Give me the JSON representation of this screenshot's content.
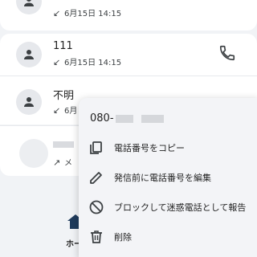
{
  "call_log": {
    "entries": [
      {
        "name": "",
        "direction_icon": "incoming-arrow-icon",
        "date": "6月15日 14:15"
      },
      {
        "name": "111",
        "direction_icon": "incoming-arrow-icon",
        "date": "6月15日 14:15"
      },
      {
        "name": "不明",
        "direction_icon": "incoming-arrow-icon",
        "date": "6月"
      },
      {
        "name": "",
        "direction_icon": "outgoing-arrow-icon",
        "date": "メ"
      }
    ]
  },
  "bottom_nav": {
    "home_label": "ホー"
  },
  "context_menu": {
    "phone_prefix": "080-",
    "items": [
      {
        "icon": "copy-icon",
        "label": "電話番号をコピー"
      },
      {
        "icon": "edit-icon",
        "label": "発信前に電話番号を編集"
      },
      {
        "icon": "block-icon",
        "label": "ブロックして迷惑電話として報告"
      },
      {
        "icon": "trash-icon",
        "label": "削除"
      }
    ]
  }
}
